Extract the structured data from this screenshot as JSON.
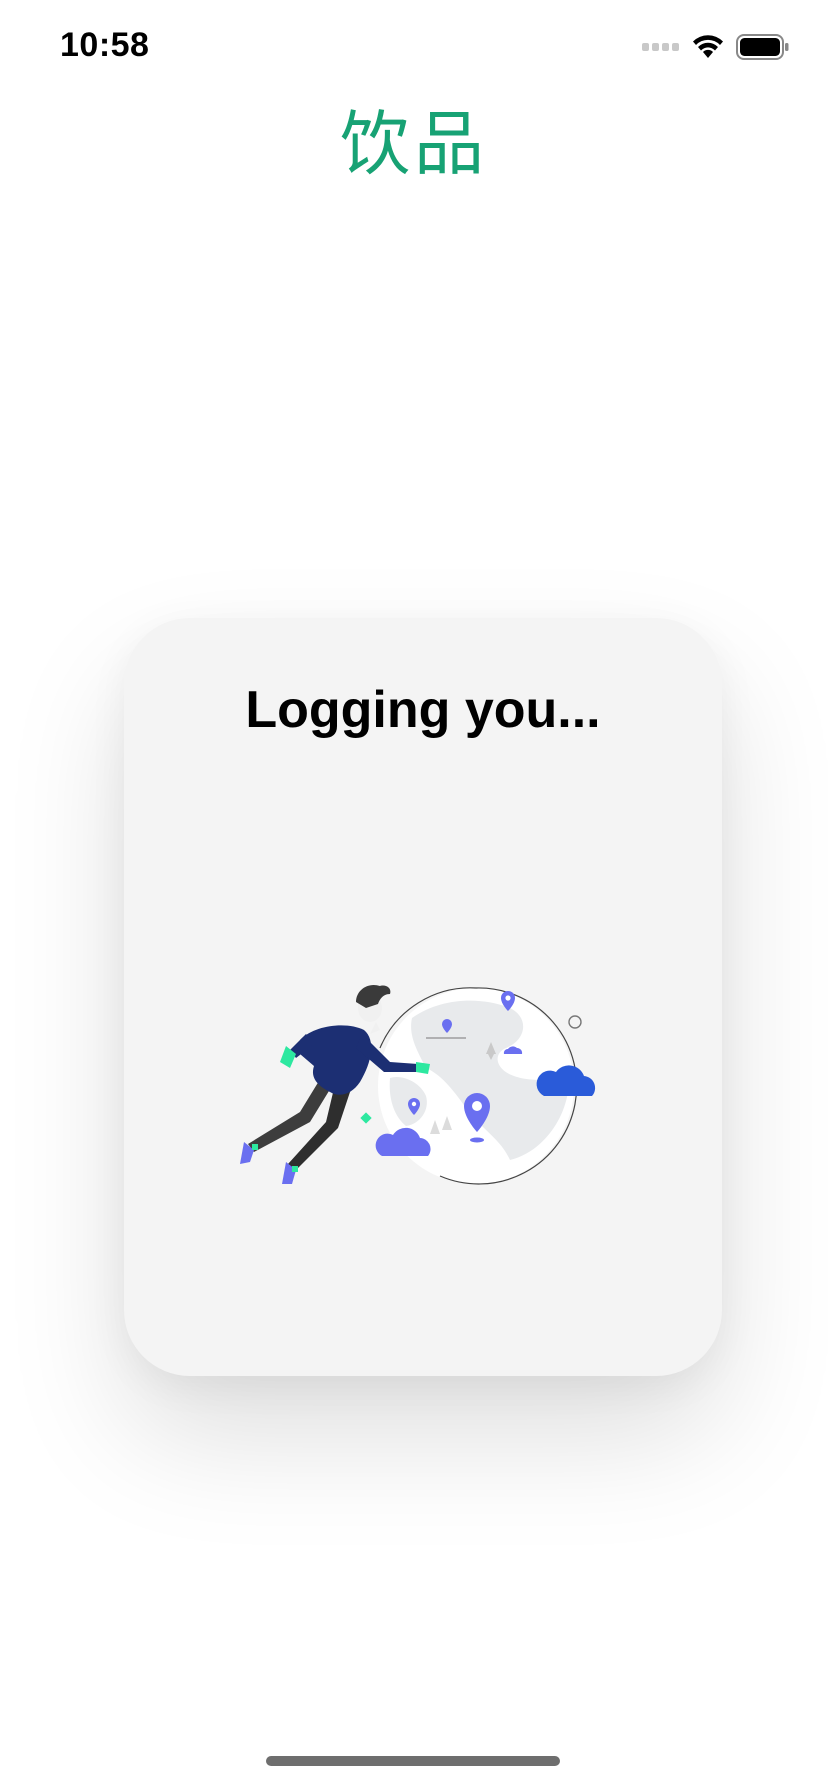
{
  "status_bar": {
    "time": "10:58"
  },
  "header": {
    "title": "饮品"
  },
  "card": {
    "title": "Logging you..."
  },
  "icons": {
    "signal": "signal-icon",
    "wifi": "wifi-icon",
    "battery": "battery-icon",
    "illustration": "floating-person-globe-illustration"
  },
  "colors": {
    "title_green": "#17a274",
    "card_bg": "#f4f4f4",
    "navy": "#1c2f73",
    "accent_blue": "#6a6ff0",
    "accent_mint": "#2de8a0"
  }
}
